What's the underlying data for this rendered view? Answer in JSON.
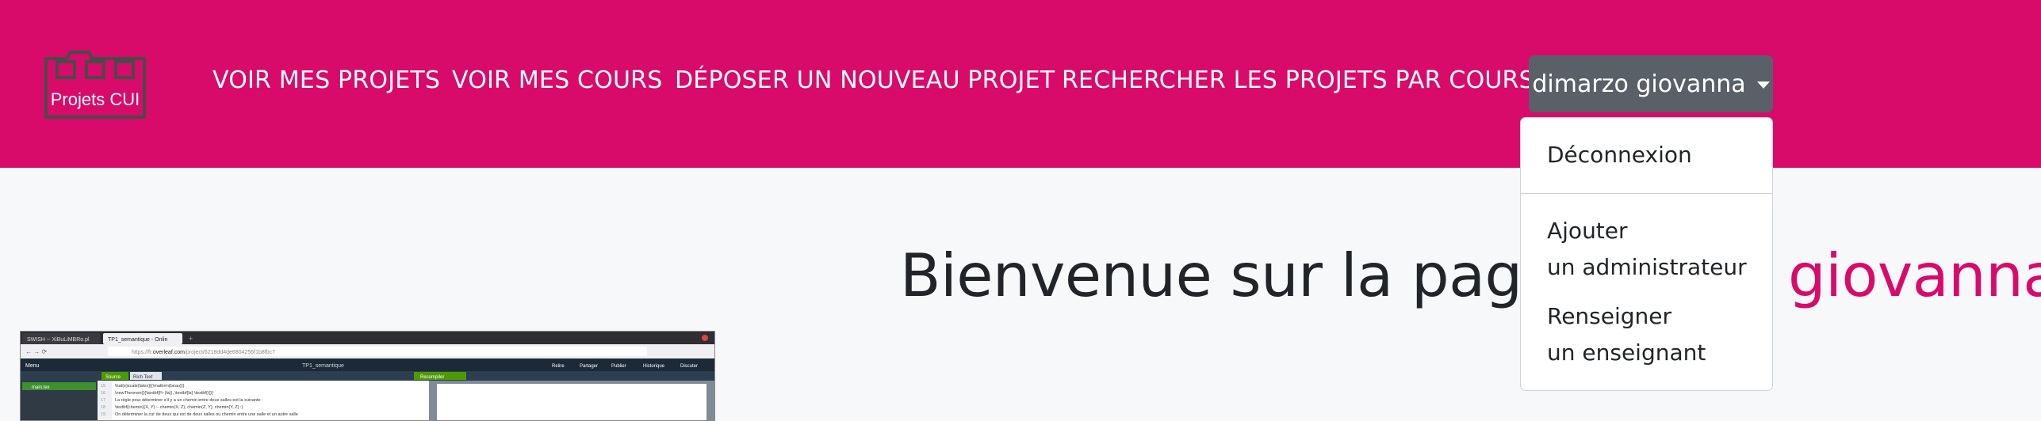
{
  "navbar": {
    "logo_text": "Projets CUI",
    "links": [
      "VOIR MES PROJETS",
      "VOIR MES COURS",
      "DÉPOSER UN NOUVEAU PROJET",
      "RECHERCHER LES PROJETS PAR COURS"
    ],
    "user_menu_label": "dimarzo giovanna"
  },
  "dropdown": {
    "logout": "Déconnexion",
    "add_admin_line1": "Ajouter",
    "add_admin_line2": "un administrateur",
    "add_teacher_line1": "Renseigner",
    "add_teacher_line2": "un enseignant"
  },
  "main": {
    "welcome_text": "Bienvenue sur la page de",
    "user_name": "giovanna"
  },
  "screenshot": {
    "tab1": "SWISH -- XiBuLiMBRo.pl",
    "tab2": "TP1_semantique - Onlin",
    "url_prefix": "https://fr.",
    "url_domain": "overleaf.com",
    "url_path": "/project/6218dd4de6804256f1b8fbc7",
    "doc_title": "TP1_semantique",
    "menu": "Menu",
    "toolbar_items": [
      "Relire",
      "Partager",
      "Publier",
      "Historique",
      "Discuter"
    ],
    "source_tab": "Source",
    "rich_text_tab": "Rich Text",
    "recompile": "Recompiler",
    "file": "main.tex",
    "lines": [
      {
        "num": "15",
        "text": "\\hat{e}scale{latex}{(\\mathrm{beau})}"
      },
      {
        "num": "16",
        "text": "\\newTheorem{}{\\textbf{Fr (la)}, \\textbf{la} \\textbf{\\{}}"
      },
      {
        "num": "17",
        "text": "La règle pour déterminer s'il y a un chemin entre deux salles est la suivante :"
      },
      {
        "num": "18",
        "text": "\\textbf{chemin}(X, Y) :- chemin(X, Z), chemin(Z, Y), chemin(Y, Z) :)"
      },
      {
        "num": "19",
        "text": "On déterminer la cur de deux qui est de deux salles ou chemin entre une salle et un autre salle"
      }
    ]
  },
  "colors": {
    "brand": "#d80a6a",
    "navbar_text": "#ffffff",
    "user_button": "#5a6068",
    "page_bg": "#f7f8fa",
    "text": "#212529"
  }
}
